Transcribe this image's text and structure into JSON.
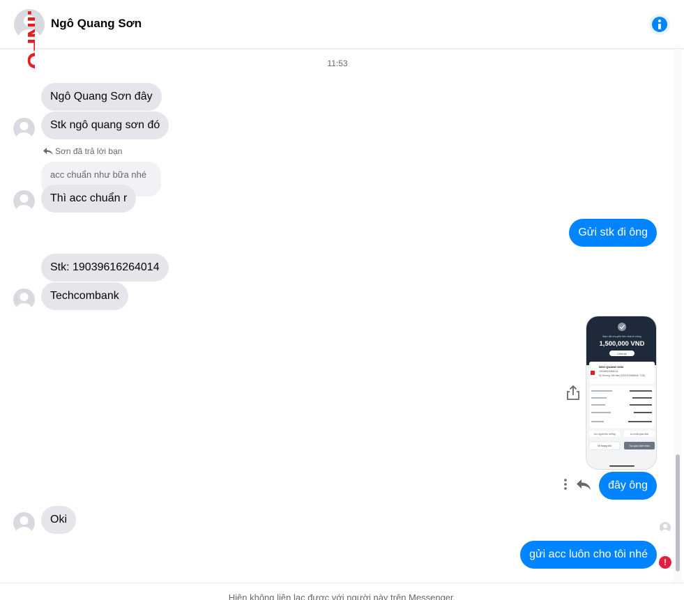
{
  "header": {
    "contact_name": "Ngô Quang Sơn",
    "info_icon": "info-icon",
    "accent_color": "#0084ff"
  },
  "watermark": {
    "text": ".INFO",
    "color": "#e41e1e"
  },
  "conversation": {
    "timestamp": "11:53",
    "messages": [
      {
        "from": "them",
        "text": "Ngô Quang Sơn đây"
      },
      {
        "from": "them",
        "text": "Stk ngô quang sơn đó"
      },
      {
        "from": "them",
        "reply_note": "Sơn đã trả lời bạn",
        "quoted": "acc chuẩn như bữa nhé",
        "text": "Thì acc chuẩn r"
      },
      {
        "from": "me",
        "text": "Gửi stk đi ông"
      },
      {
        "from": "them",
        "text": "Stk: 19039616264014"
      },
      {
        "from": "them",
        "text": "Techcombank"
      },
      {
        "from": "me",
        "type": "image",
        "image": {
          "amount": "1,500,000 VND",
          "title": "Bạn đã chuyển tiền thành công",
          "share_label": "Chia sẻ",
          "recipient_name": "NGO QUANG SON",
          "recipient_account": "19039616264014",
          "bank": "Kỹ Thương Việt Nam (TECHCOMBANK, TCB)",
          "save_label": "Lưu người thụ hưởng",
          "save_template_label": "Lưu mẫu giao dịch",
          "home_button": "Về trang chủ",
          "new_transfer_button": "Tạo giao dịch khác"
        }
      },
      {
        "from": "me",
        "text": "đây ông"
      },
      {
        "from": "them",
        "text": "Oki"
      },
      {
        "from": "me",
        "text": "gửi acc luôn cho tôi nhé",
        "status": "error"
      }
    ]
  },
  "footer": {
    "notice": "Hiện không liên lạc được với người này trên Messenger."
  }
}
